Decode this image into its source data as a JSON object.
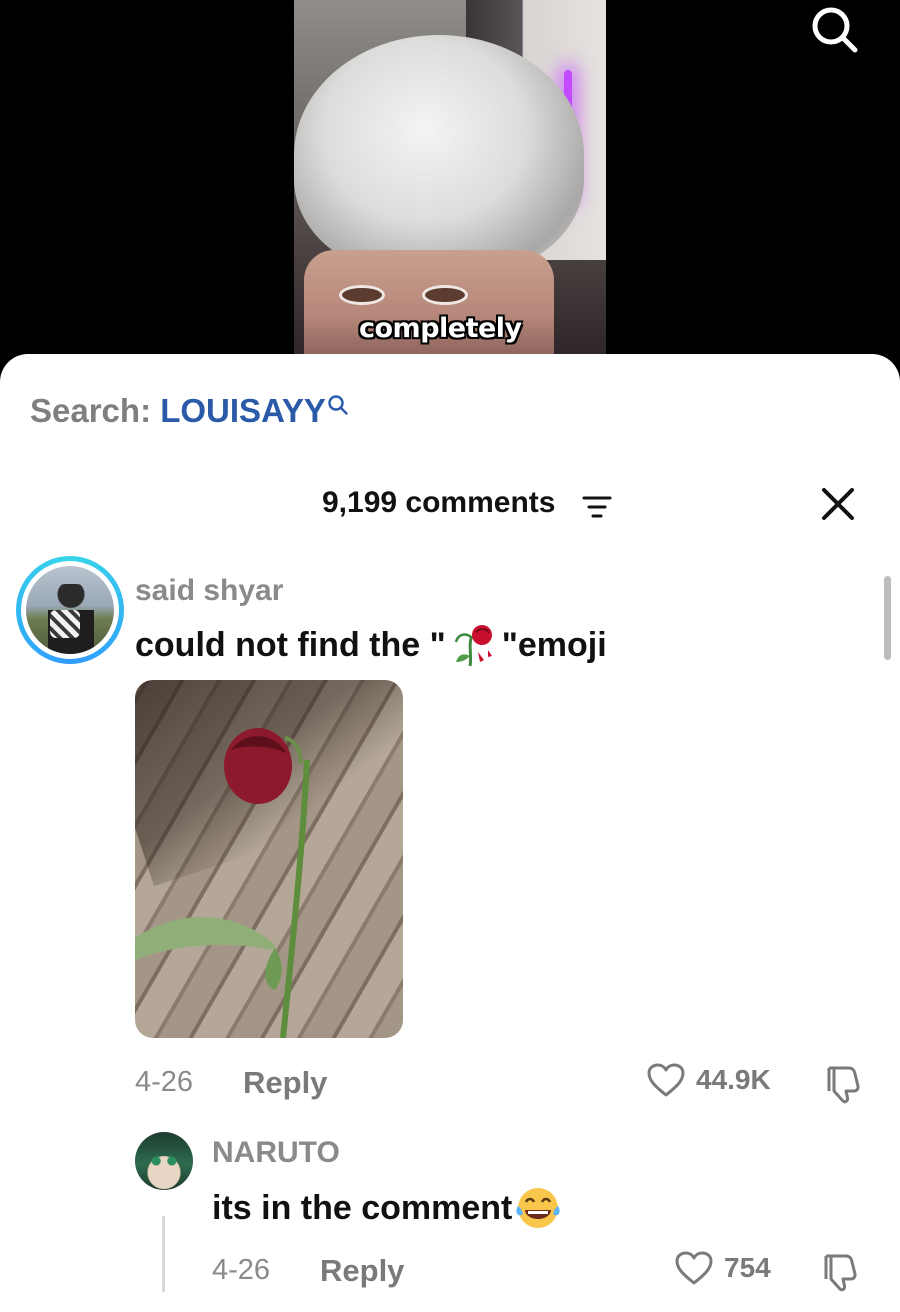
{
  "video": {
    "caption": "completely",
    "search_icon": "search-icon"
  },
  "search_bar": {
    "prefix": "Search:",
    "query": "LOUISAYY",
    "icon": "search-icon"
  },
  "comments_header": {
    "count_label": "9,199 comments",
    "filter_icon": "filter-icon",
    "close_icon": "close-icon"
  },
  "comments": [
    {
      "username": "said shyar",
      "text_before": "could not find the \"",
      "emoji": "wilted-rose-emoji",
      "text_after": "\"emoji",
      "attachment": "rose-photo",
      "date": "4-26",
      "reply_label": "Reply",
      "likes": "44.9K"
    }
  ],
  "replies": [
    {
      "username": "NARUTO",
      "text": "its in the comment",
      "emoji": "tears-of-joy-emoji",
      "date": "4-26",
      "reply_label": "Reply",
      "likes": "754"
    }
  ],
  "colors": {
    "search_query": "#2a5aa8",
    "avatar_ring": "#38d6e8",
    "muted_text": "#8a8a8a",
    "primary_text": "#111111"
  }
}
